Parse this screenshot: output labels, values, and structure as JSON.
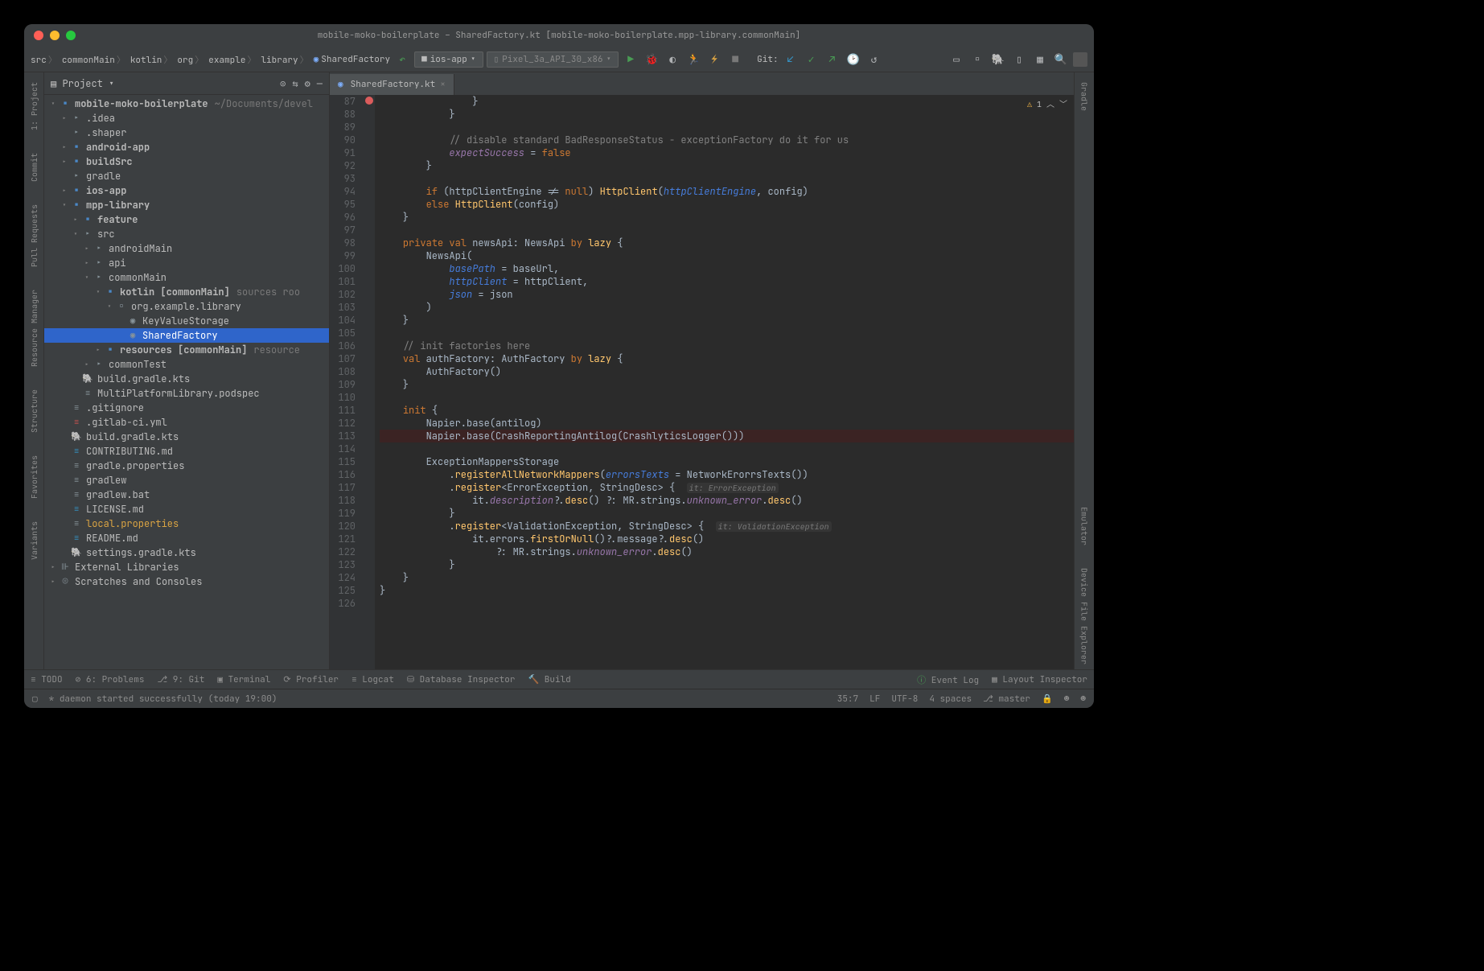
{
  "title": "mobile-moko-boilerplate – SharedFactory.kt [mobile-moko-boilerplate.mpp-library.commonMain]",
  "breadcrumbs": [
    "src",
    "commonMain",
    "kotlin",
    "org",
    "example",
    "library",
    "SharedFactory"
  ],
  "run_config_1": "ios-app",
  "run_config_2": "Pixel_3a_API_30_x86",
  "git_label": "Git:",
  "sidebar_title": "Project",
  "tree": {
    "root": "mobile-moko-boilerplate",
    "root_path": "~/Documents/devel",
    "idea": ".idea",
    "shaper": ".shaper",
    "android": "android-app",
    "buildsrc": "buildSrc",
    "gradle": "gradle",
    "ios": "ios-app",
    "mpp": "mpp-library",
    "feature": "feature",
    "src": "src",
    "androidMain": "androidMain",
    "api": "api",
    "commonMain": "commonMain",
    "kotlin_cm": "kotlin [commonMain]",
    "kotlin_cm_hint": "sources roo",
    "pkg": "org.example.library",
    "kvs": "KeyValueStorage",
    "sf": "SharedFactory",
    "resources": "resources [commonMain]",
    "resources_hint": "resource",
    "commonTest": "commonTest",
    "build_gradle": "build.gradle.kts",
    "podspec": "MultiPlatformLibrary.podspec",
    "gitignore": ".gitignore",
    "gitlab": ".gitlab-ci.yml",
    "root_build": "build.gradle.kts",
    "contrib": "CONTRIBUTING.md",
    "gradle_props": "gradle.properties",
    "gradlew": "gradlew",
    "gradlew_bat": "gradlew.bat",
    "license": "LICENSE.md",
    "local_props": "local.properties",
    "readme": "README.md",
    "settings": "settings.gradle.kts",
    "ext_libs": "External Libraries",
    "scratches": "Scratches and Consoles"
  },
  "tab_name": "SharedFactory.kt",
  "inspections": {
    "warnings": "1"
  },
  "code_lines": [
    {
      "n": 87,
      "html": "                }"
    },
    {
      "n": 88,
      "html": "            }"
    },
    {
      "n": 89,
      "html": ""
    },
    {
      "n": 90,
      "html": "            <span class='cm'>// disable standard BadResponseStatus - exceptionFactory do it for us</span>"
    },
    {
      "n": 91,
      "html": "            <span class='prop'>expectSuccess</span> = <span class='kw'>false</span>"
    },
    {
      "n": 92,
      "html": "        }"
    },
    {
      "n": 93,
      "html": ""
    },
    {
      "n": 94,
      "html": "        <span class='kw'>if</span> (httpClientEngine != <span class='kw'>null</span>) <span class='fn'>HttpClient</span>(<span class='param'>httpClientEngine</span>, config)"
    },
    {
      "n": 95,
      "html": "        <span class='kw'>else</span> <span class='fn'>HttpClient</span>(config)"
    },
    {
      "n": 96,
      "html": "    }"
    },
    {
      "n": 97,
      "html": ""
    },
    {
      "n": 98,
      "html": "    <span class='kw'>private val</span> newsApi: NewsApi <span class='kw'>by</span> <span class='fn'>lazy</span> {"
    },
    {
      "n": 99,
      "html": "        NewsApi("
    },
    {
      "n": 100,
      "html": "            <span class='param'>basePath</span> = baseUrl,"
    },
    {
      "n": 101,
      "html": "            <span class='param'>httpClient</span> = httpClient,"
    },
    {
      "n": 102,
      "html": "            <span class='param'>json</span> = json"
    },
    {
      "n": 103,
      "html": "        )"
    },
    {
      "n": 104,
      "html": "    }"
    },
    {
      "n": 105,
      "html": ""
    },
    {
      "n": 106,
      "html": "    <span class='cm'>// init factories here</span>"
    },
    {
      "n": 107,
      "html": "    <span class='kw'>val</span> authFactory: AuthFactory <span class='kw'>by</span> <span class='fn'>lazy</span> {"
    },
    {
      "n": 108,
      "html": "        AuthFactory()"
    },
    {
      "n": 109,
      "html": "    }"
    },
    {
      "n": 110,
      "html": ""
    },
    {
      "n": 111,
      "html": "    <span class='kw'>init</span> {"
    },
    {
      "n": 112,
      "html": "        Napier.base(antilog)"
    },
    {
      "n": 113,
      "html": "        Napier.base(CrashReportingAntilog(CrashlyticsLogger()))",
      "err": true,
      "bp": true
    },
    {
      "n": 114,
      "html": ""
    },
    {
      "n": 115,
      "html": "        ExceptionMappersStorage"
    },
    {
      "n": 116,
      "html": "            .<span class='fn'>registerAllNetworkMappers</span>(<span class='param'>errorsTexts</span> = NetworkErorrsTexts())"
    },
    {
      "n": 117,
      "html": "            .<span class='fn'>register</span>&lt;ErrorException, StringDesc&gt; {  <span class='hint'>it: ErrorException</span>"
    },
    {
      "n": 118,
      "html": "                it.<span class='prop'>description</span>?.<span class='fn'>desc</span>() ?: MR.strings.<span class='prop'>unknown_error</span>.<span class='fn'>desc</span>()"
    },
    {
      "n": 119,
      "html": "            }"
    },
    {
      "n": 120,
      "html": "            .<span class='fn'>register</span>&lt;ValidationException, StringDesc&gt; {  <span class='hint'>it: ValidationException</span>"
    },
    {
      "n": 121,
      "html": "                it.errors.<span class='fn'>firstOrNull</span>()?.message?.<span class='fn'>desc</span>()"
    },
    {
      "n": 122,
      "html": "                    ?: MR.strings.<span class='prop'>unknown_error</span>.<span class='fn'>desc</span>()"
    },
    {
      "n": 123,
      "html": "            }"
    },
    {
      "n": 124,
      "html": "    }"
    },
    {
      "n": 125,
      "html": "}"
    },
    {
      "n": 126,
      "html": ""
    }
  ],
  "left_tools": [
    "1: Project",
    "Commit",
    "Pull Requests",
    "Resource Manager",
    "Structure",
    "Favorites",
    "Variants"
  ],
  "right_tools": [
    "Gradle",
    "Emulator",
    "Device File Explorer"
  ],
  "bottom_tools": {
    "todo": "TODO",
    "problems": "6: Problems",
    "git": "9: Git",
    "terminal": "Terminal",
    "profiler": "Profiler",
    "logcat": "Logcat",
    "db": "Database Inspector",
    "build": "Build",
    "event_log": "Event Log",
    "layout_insp": "Layout Inspector"
  },
  "status": {
    "msg": "* daemon started successfully (today 19:00)",
    "pos": "35:7",
    "sep": "LF",
    "enc": "UTF-8",
    "indent": "4 spaces",
    "branch": "master"
  }
}
